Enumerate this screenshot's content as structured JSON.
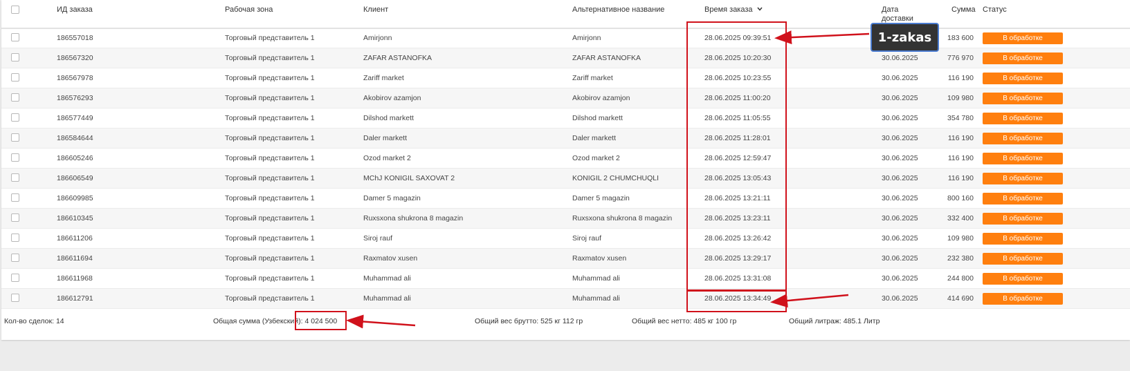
{
  "columns": {
    "id": "ИД заказа",
    "zone": "Рабочая зона",
    "client": "Клиент",
    "alt_name": "Альтернативное название",
    "order_time": "Время заказа",
    "sort_indicator": "chevron-down-icon",
    "delivery_date_line1": "Дата",
    "delivery_date_line2": "доставки",
    "sum": "Сумма",
    "status": "Статус"
  },
  "rows": [
    {
      "id": "186557018",
      "zone": "Торговый представитель 1",
      "client": "Amirjonn",
      "alt": "Amirjonn",
      "time": "28.06.2025 09:39:51",
      "date": "",
      "sum": "183 600",
      "status": "В обработке"
    },
    {
      "id": "186567320",
      "zone": "Торговый представитель 1",
      "client": "ZAFAR ASTANOFKA",
      "alt": "ZAFAR ASTANOFKA",
      "time": "28.06.2025 10:20:30",
      "date": "30.06.2025",
      "sum": "776 970",
      "status": "В обработке"
    },
    {
      "id": "186567978",
      "zone": "Торговый представитель 1",
      "client": "Zariff market",
      "alt": "Zariff market",
      "time": "28.06.2025 10:23:55",
      "date": "30.06.2025",
      "sum": "116 190",
      "status": "В обработке"
    },
    {
      "id": "186576293",
      "zone": "Торговый представитель 1",
      "client": "Akobirov azamjon",
      "alt": "Akobirov azamjon",
      "time": "28.06.2025 11:00:20",
      "date": "30.06.2025",
      "sum": "109 980",
      "status": "В обработке"
    },
    {
      "id": "186577449",
      "zone": "Торговый представитель 1",
      "client": "Dilshod markett",
      "alt": "Dilshod markett",
      "time": "28.06.2025 11:05:55",
      "date": "30.06.2025",
      "sum": "354 780",
      "status": "В обработке"
    },
    {
      "id": "186584644",
      "zone": "Торговый представитель 1",
      "client": "Daler markett",
      "alt": "Daler markett",
      "time": "28.06.2025 11:28:01",
      "date": "30.06.2025",
      "sum": "116 190",
      "status": "В обработке"
    },
    {
      "id": "186605246",
      "zone": "Торговый представитель 1",
      "client": "Ozod market 2",
      "alt": "Ozod market 2",
      "time": "28.06.2025 12:59:47",
      "date": "30.06.2025",
      "sum": "116 190",
      "status": "В обработке"
    },
    {
      "id": "186606549",
      "zone": "Торговый представитель 1",
      "client": "MChJ KONIGIL SAXOVAT 2",
      "alt": "KONIGIL 2 CHUMCHUQLI",
      "time": "28.06.2025 13:05:43",
      "date": "30.06.2025",
      "sum": "116 190",
      "status": "В обработке"
    },
    {
      "id": "186609985",
      "zone": "Торговый представитель 1",
      "client": "Damer 5 magazin",
      "alt": "Damer 5 magazin",
      "time": "28.06.2025 13:21:11",
      "date": "30.06.2025",
      "sum": "800 160",
      "status": "В обработке"
    },
    {
      "id": "186610345",
      "zone": "Торговый представитель 1",
      "client": "Ruxsxona shukrona 8 magazin",
      "alt": "Ruxsxona shukrona 8 magazin",
      "time": "28.06.2025 13:23:11",
      "date": "30.06.2025",
      "sum": "332 400",
      "status": "В обработке"
    },
    {
      "id": "186611206",
      "zone": "Торговый представитель 1",
      "client": "Siroj rauf",
      "alt": "Siroj rauf",
      "time": "28.06.2025 13:26:42",
      "date": "30.06.2025",
      "sum": "109 980",
      "status": "В обработке"
    },
    {
      "id": "186611694",
      "zone": "Торговый представитель 1",
      "client": "Raxmatov xusen",
      "alt": "Raxmatov xusen",
      "time": "28.06.2025 13:29:17",
      "date": "30.06.2025",
      "sum": "232 380",
      "status": "В обработке"
    },
    {
      "id": "186611968",
      "zone": "Торговый представитель 1",
      "client": "Muhammad ali",
      "alt": "Muhammad ali",
      "time": "28.06.2025 13:31:08",
      "date": "30.06.2025",
      "sum": "244 800",
      "status": "В обработке"
    },
    {
      "id": "186612791",
      "zone": "Торговый представитель 1",
      "client": "Muhammad ali",
      "alt": "Muhammad ali",
      "time": "28.06.2025 13:34:49",
      "date": "30.06.2025",
      "sum": "414 690",
      "status": "В обработке"
    }
  ],
  "footer": {
    "deals_count": "Кол-во сделок: 14",
    "total_sum_label": "Общая сумма (Узбекский",
    "total_sum_value": "): 4 024 500",
    "gross_weight": "Общий вес брутто: 525 кг 112 гр",
    "net_weight": "Общий вес нетто: 485 кг 100 гр",
    "total_volume": "Общий литраж: 485.1 Литр"
  },
  "annotation": {
    "callout_text": "1-zakas",
    "highlight_color": "#d0111b"
  },
  "colors": {
    "status_badge": "#ff7f0e",
    "row_alt": "#f6f6f6"
  }
}
